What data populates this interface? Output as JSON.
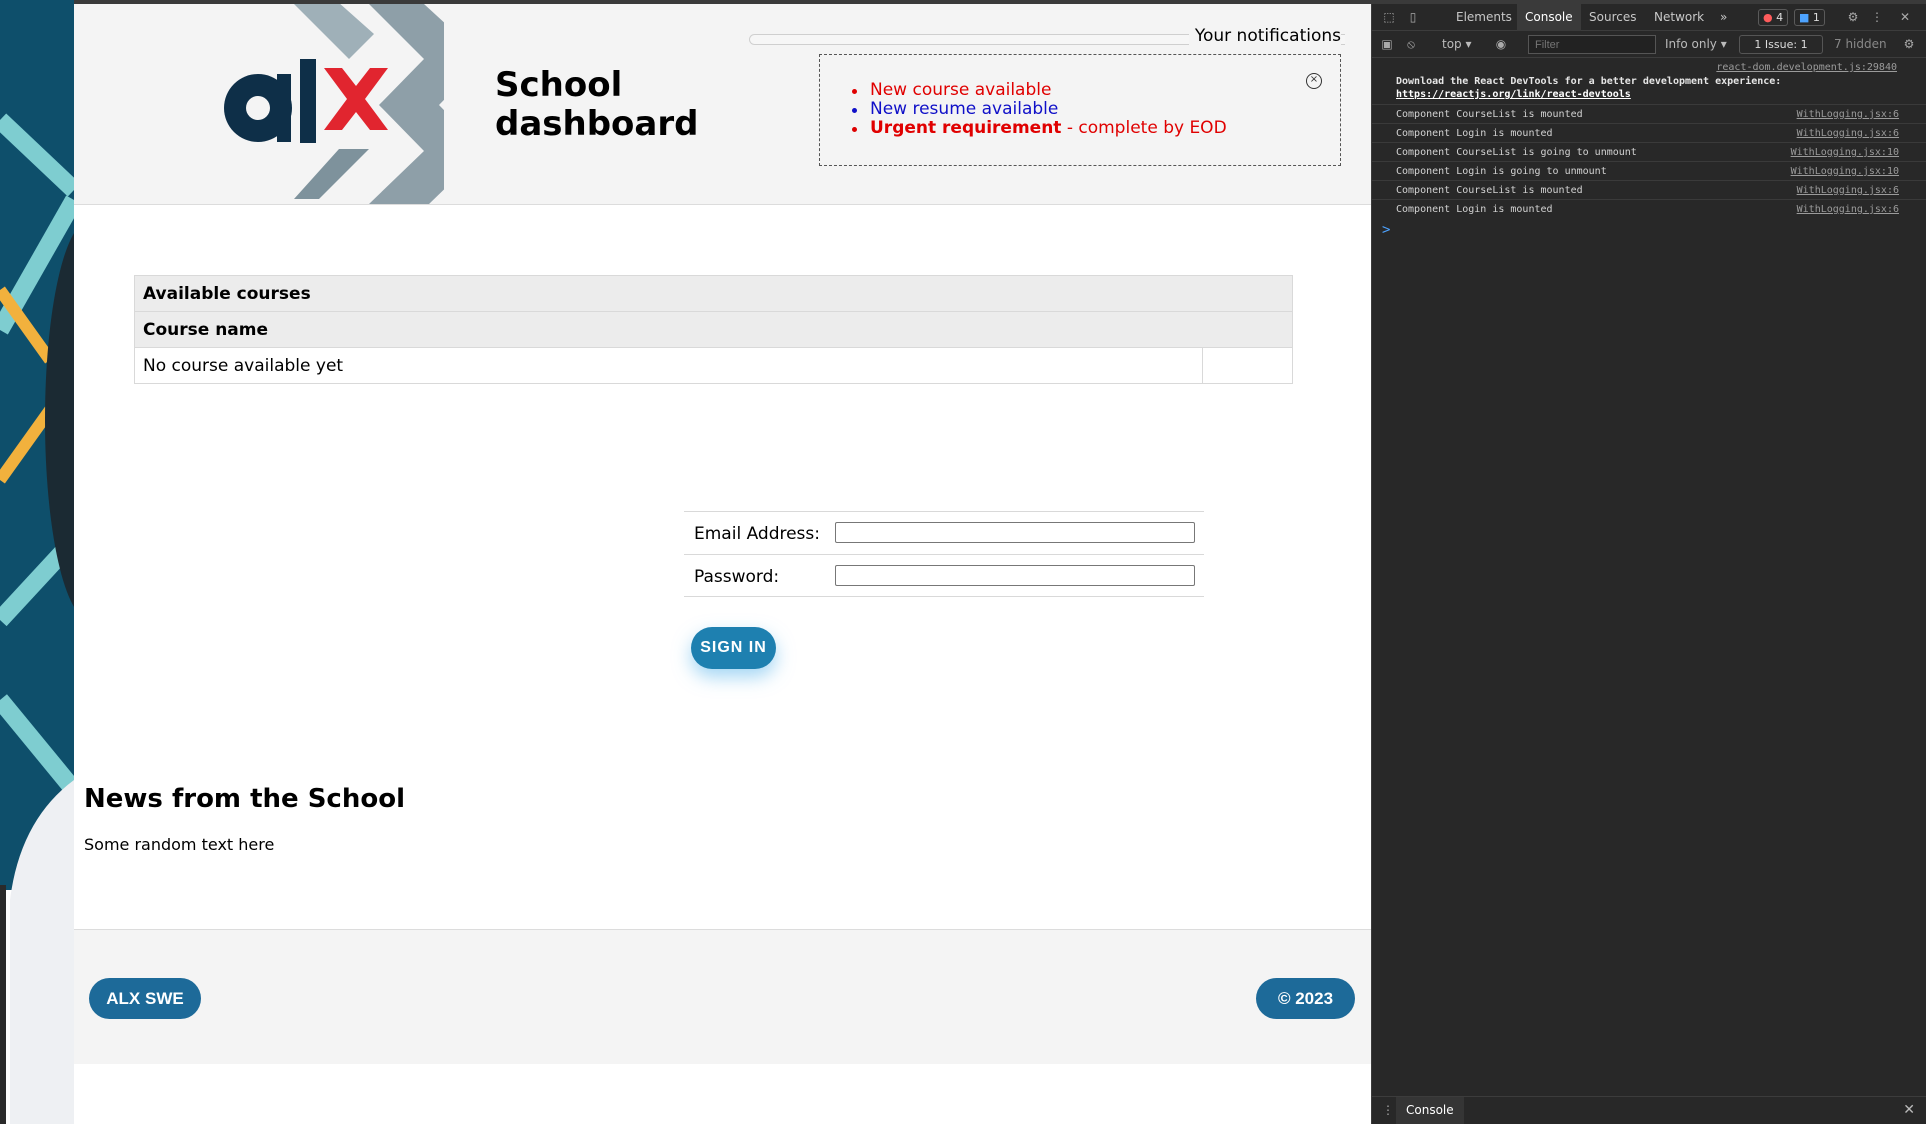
{
  "header": {
    "title": "School dashboard",
    "logo_text": "alx"
  },
  "notifications": {
    "title": "Your notifications",
    "close_label": "×",
    "items": [
      {
        "text": "New course available",
        "color": "#e00000"
      },
      {
        "text": "New resume available",
        "color": "#1010c8"
      }
    ],
    "urgent": {
      "strong": "Urgent requirement",
      "rest": " - complete by EOD"
    }
  },
  "courses": {
    "caption": "Available courses",
    "column_header": "Course name",
    "empty_message": "No course available yet"
  },
  "login": {
    "email_label": "Email Address:",
    "password_label": "Password:",
    "submit_label": "SIGN IN"
  },
  "news": {
    "title": "News from the School",
    "body": "Some random text here"
  },
  "footer": {
    "left_label": "ALX SWE",
    "right_label": "© 2023"
  },
  "devtools": {
    "tabs": [
      "Elements",
      "Console",
      "Sources",
      "Network"
    ],
    "active_tab": "Console",
    "more": "»",
    "errors_badge": "4",
    "messages_badge": "1",
    "context": "top ▾",
    "filter_placeholder": "Filter",
    "level": "Info only ▾",
    "issues": "1 Issue:  1",
    "hidden": "7 hidden",
    "react_src": "react-dom.development.js:29840",
    "react_msg": "Download the React DevTools for a better development experience: ",
    "react_link": "https://reactjs.org/link/react-devtools",
    "logs": [
      {
        "msg": "Component CourseList is mounted",
        "src": "WithLogging.jsx:6"
      },
      {
        "msg": "Component Login is mounted",
        "src": "WithLogging.jsx:6"
      },
      {
        "msg": "Component CourseList is going to unmount",
        "src": "WithLogging.jsx:10"
      },
      {
        "msg": "Component Login is going to unmount",
        "src": "WithLogging.jsx:10"
      },
      {
        "msg": "Component CourseList is mounted",
        "src": "WithLogging.jsx:6"
      },
      {
        "msg": "Component Login is mounted",
        "src": "WithLogging.jsx:6"
      }
    ],
    "prompt": ">",
    "drawer_tab": "Console"
  },
  "colors": {
    "accent_blue": "#1e80b0",
    "footer_pill": "#1d6a99",
    "logo_red": "#e1252f",
    "logo_navy": "#0e2f48"
  }
}
